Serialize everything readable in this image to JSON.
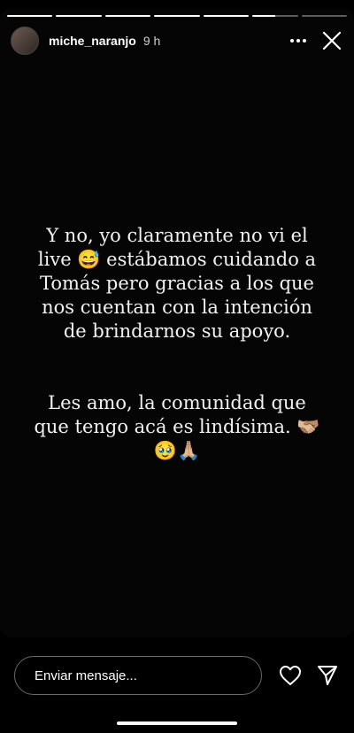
{
  "story": {
    "progress_segments": [
      1,
      1,
      1,
      1,
      1,
      0.5,
      0
    ],
    "username": "miche_naranjo",
    "time": "9 h",
    "text_para1": "Y no, yo claramente no vi el live 😅 estábamos cuidando a Tomás pero gracias a los que nos cuentan con la intención de brindarnos su apoyo.",
    "text_para2": "Les amo, la comunidad que que tengo acá es lindísima. 🫱🏼‍🫲🏽🥹🙏🏼"
  },
  "bottom": {
    "message_placeholder": "Enviar mensaje..."
  },
  "icons": {
    "more": "more-icon",
    "close": "close-icon",
    "heart": "heart-icon",
    "send": "send-icon"
  }
}
